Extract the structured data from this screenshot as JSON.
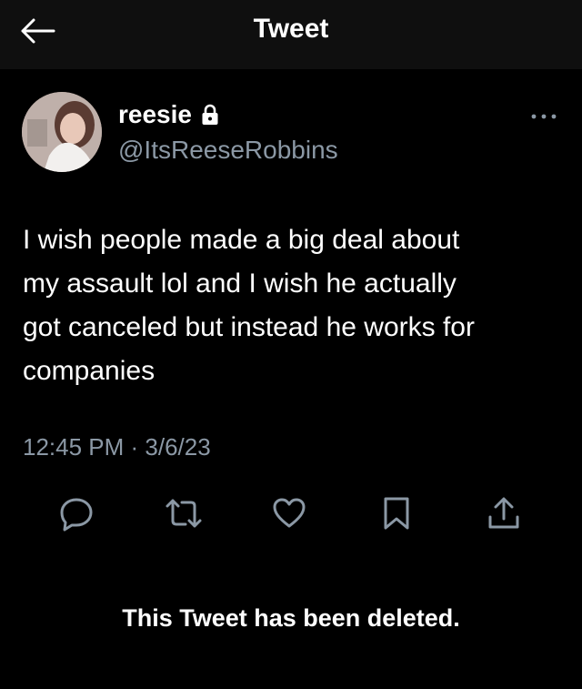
{
  "header": {
    "title": "Tweet",
    "back_icon": "arrow-left-icon"
  },
  "tweet": {
    "author": {
      "display_name": "reesie",
      "handle": "@ItsReeseRobbins",
      "protected_icon": "lock-icon"
    },
    "text": "I wish people made a big deal about\nmy assault lol and I wish he actually\ngot canceled but instead he works for\ncompanies",
    "timestamp": "12:45 PM · 3/6/23",
    "more_icon": "more-dots-icon",
    "actions": [
      {
        "name": "reply",
        "icon": "reply-icon"
      },
      {
        "name": "retweet",
        "icon": "retweet-icon"
      },
      {
        "name": "like",
        "icon": "heart-icon"
      },
      {
        "name": "bookmark",
        "icon": "bookmark-icon"
      },
      {
        "name": "share",
        "icon": "share-icon"
      }
    ]
  },
  "notice": {
    "deleted_text": "This Tweet has been deleted."
  },
  "colors": {
    "background": "#000000",
    "header_bg": "#0f0f0f",
    "primary_text": "#ffffff",
    "secondary_text": "#8b98a5",
    "icon_color": "#8b98a5"
  }
}
